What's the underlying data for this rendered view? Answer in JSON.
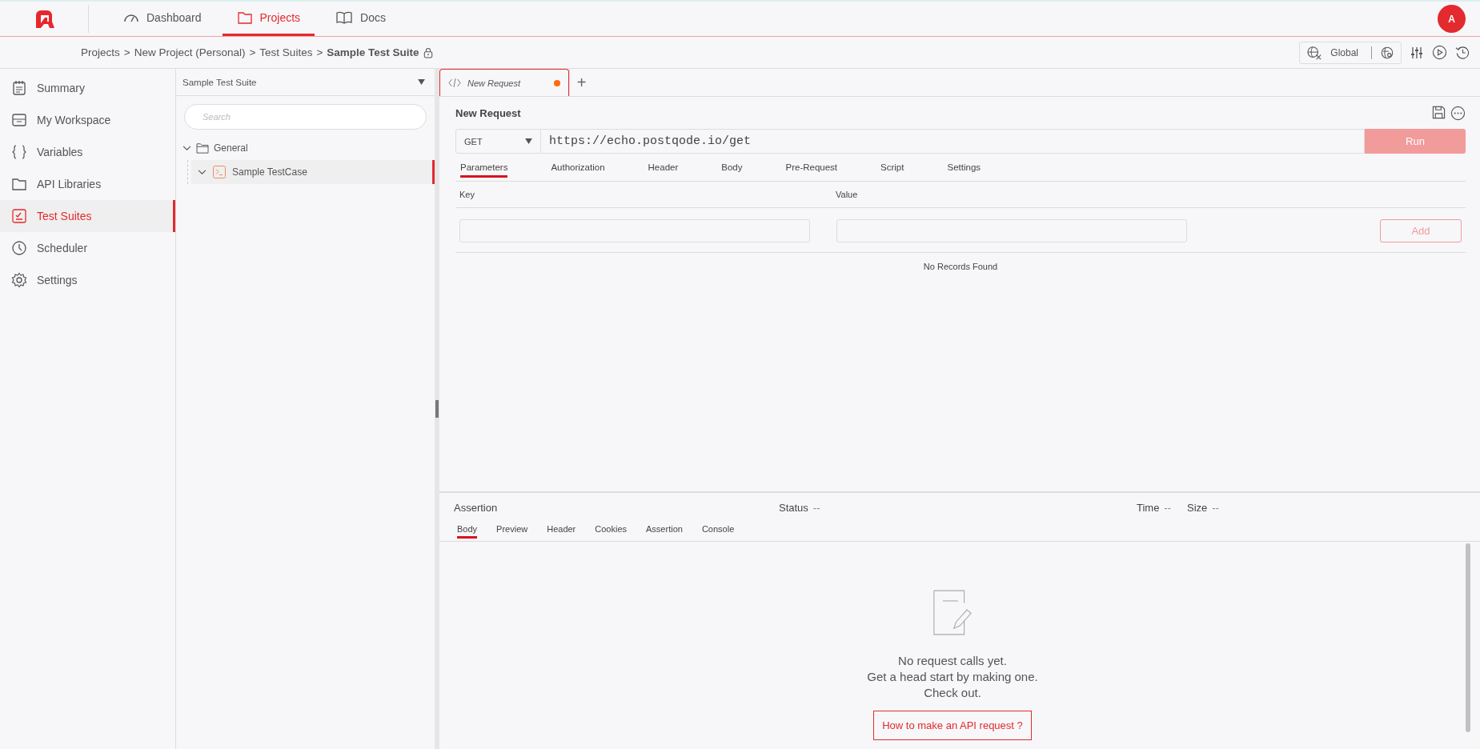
{
  "nav": {
    "tabs": [
      {
        "label": "Dashboard",
        "selected": false
      },
      {
        "label": "Projects",
        "selected": true
      },
      {
        "label": "Docs",
        "selected": false
      }
    ],
    "avatar": "A"
  },
  "breadcrumb": {
    "items": [
      "Projects",
      "New Project (Personal)",
      "Test Suites"
    ],
    "separator": ">",
    "current": "Sample Test Suite",
    "locked": true
  },
  "toolbar": {
    "environment": "Global"
  },
  "sidebar": {
    "items": [
      {
        "label": "Summary",
        "selected": false
      },
      {
        "label": "My Workspace",
        "selected": false
      },
      {
        "label": "Variables",
        "selected": false
      },
      {
        "label": "API Libraries",
        "selected": false
      },
      {
        "label": "Test Suites",
        "selected": true
      },
      {
        "label": "Scheduler",
        "selected": false
      },
      {
        "label": "Settings",
        "selected": false
      }
    ]
  },
  "tree": {
    "suite": "Sample Test Suite",
    "search": {
      "placeholder": "Search"
    },
    "nodes": [
      {
        "label": "General",
        "kind": "folder",
        "expanded": true,
        "selected": false,
        "children": [
          {
            "label": "Sample TestCase",
            "kind": "testcase",
            "expanded": true,
            "selected": true
          }
        ]
      }
    ]
  },
  "request_tabs": [
    {
      "label": "New Request",
      "unsaved": true,
      "selected": true
    }
  ],
  "add_tab": "+",
  "request": {
    "title": "New Request",
    "method": "GET",
    "url": "https://echo.postqode.io/get",
    "run": "Run",
    "tabs": [
      {
        "label": "Parameters",
        "selected": true
      },
      {
        "label": "Authorization",
        "selected": false
      },
      {
        "label": "Header",
        "selected": false
      },
      {
        "label": "Body",
        "selected": false
      },
      {
        "label": "Pre-Request",
        "selected": false
      },
      {
        "label": "Script",
        "selected": false
      },
      {
        "label": "Settings",
        "selected": false
      }
    ],
    "params": {
      "columns": [
        "Key",
        "Value"
      ],
      "add": "Add",
      "empty": "No Records Found"
    }
  },
  "response": {
    "title": "Assertion",
    "status": {
      "label": "Status",
      "value": "--"
    },
    "time": {
      "label": "Time",
      "value": "--"
    },
    "size": {
      "label": "Size",
      "value": "--"
    },
    "tabs": [
      {
        "label": "Body",
        "selected": true
      },
      {
        "label": "Preview",
        "selected": false
      },
      {
        "label": "Header",
        "selected": false
      },
      {
        "label": "Cookies",
        "selected": false
      },
      {
        "label": "Assertion",
        "selected": false
      },
      {
        "label": "Console",
        "selected": false
      }
    ],
    "empty_lines": [
      "No request calls yet.",
      "Get a head start by making one.",
      "Check out."
    ],
    "link": "How to make an API request ?"
  }
}
